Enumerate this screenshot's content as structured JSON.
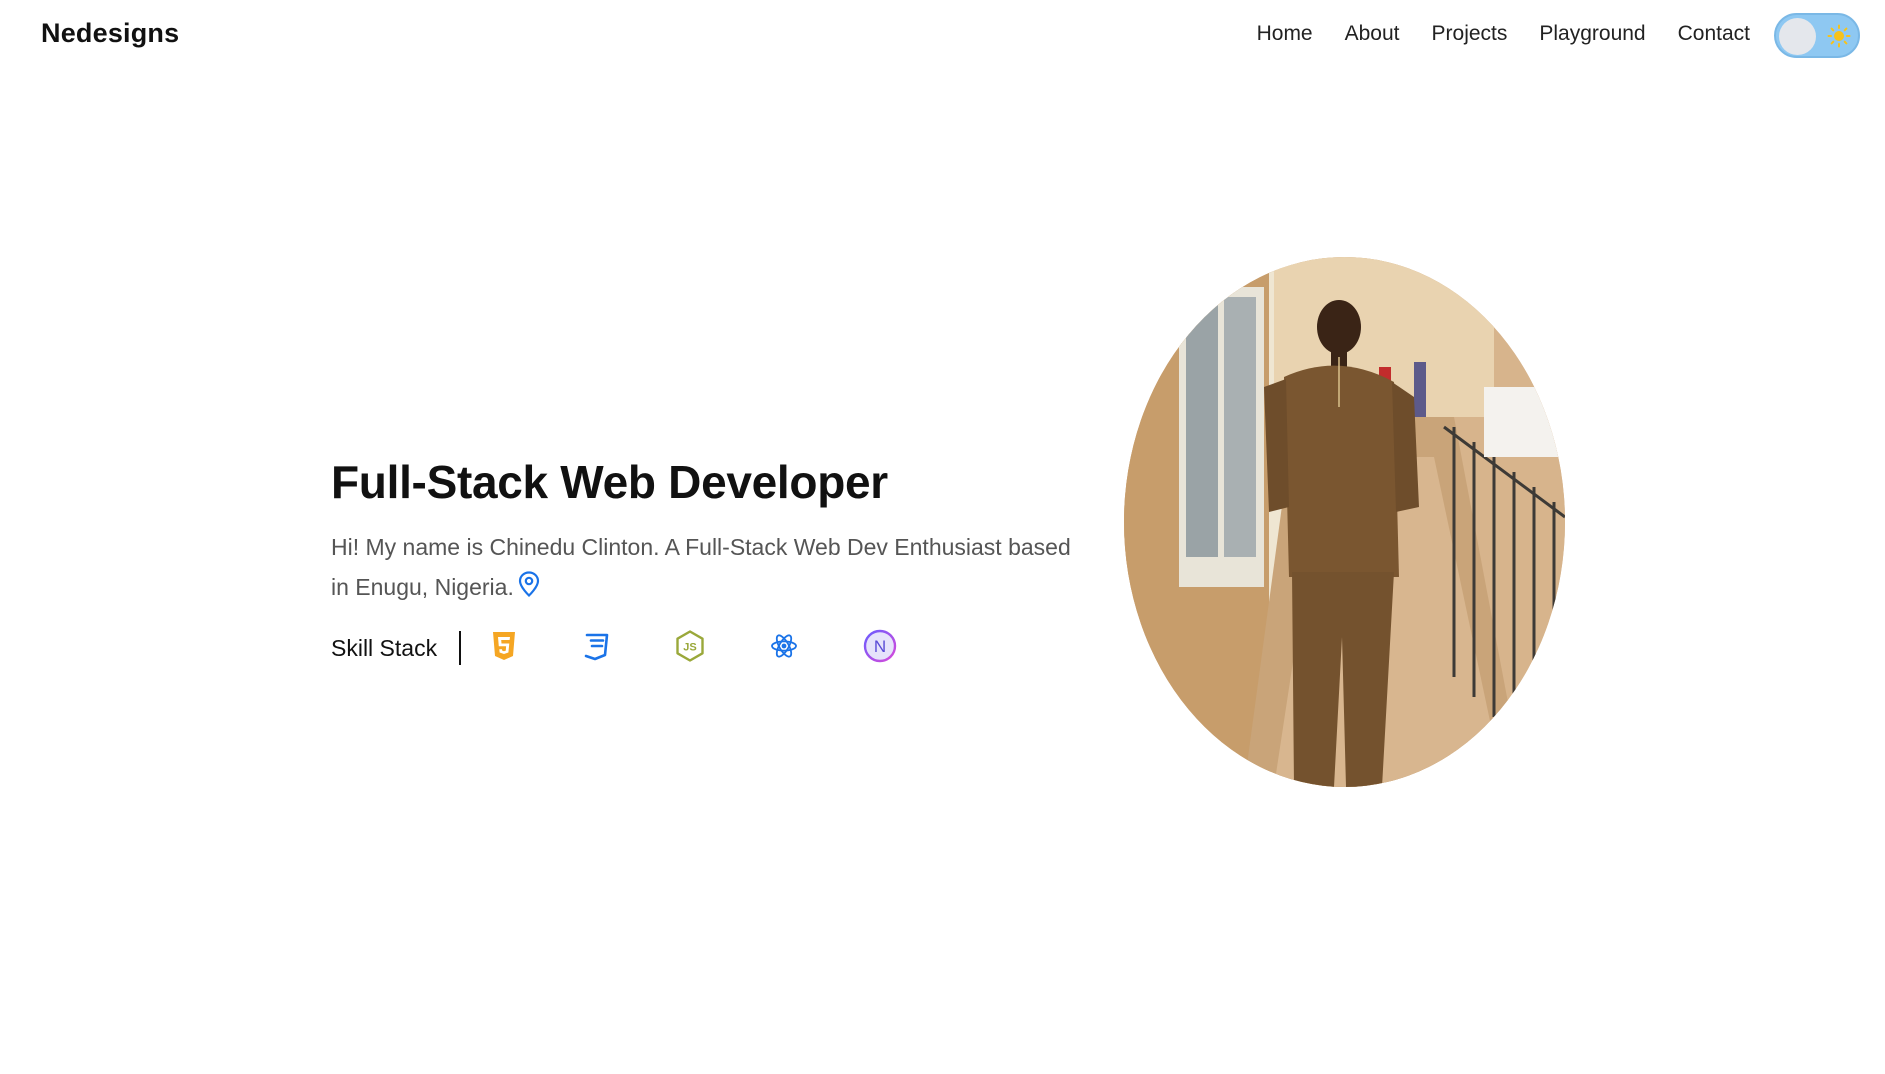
{
  "header": {
    "logo": "Nedesigns",
    "nav": [
      "Home",
      "About",
      "Projects",
      "Playground",
      "Contact"
    ]
  },
  "theme_toggle": {
    "state": "light",
    "icon": "sun-icon"
  },
  "hero": {
    "title": "Full-Stack Web Developer",
    "description": "Hi! My name is Chinedu Clinton. A Full-Stack Web Dev Enthusiast based in Enugu, Nigeria.",
    "location_icon": "map-pin-icon",
    "skills_label": "Skill Stack",
    "skills": [
      "html5-icon",
      "css3-icon",
      "nodejs-icon",
      "react-icon",
      "nextjs-icon"
    ]
  },
  "colors": {
    "accent_blue": "#1a73e8",
    "html_orange": "#f5a623",
    "node_green": "#9aa83a",
    "toggle_bg": "#8ec8f2",
    "text_muted": "#555555"
  }
}
